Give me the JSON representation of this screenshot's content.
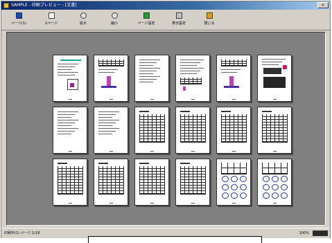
{
  "window": {
    "title": "SAMPLE - 印刷プレビュー - [文書]",
    "close_label": "×"
  },
  "toolbar": {
    "buttons": [
      {
        "label": "ページ(1)"
      },
      {
        "label": "2ページ"
      },
      {
        "label": "拡大"
      },
      {
        "label": "縮小"
      },
      {
        "label": "ページ設定"
      },
      {
        "label": "表示設定"
      },
      {
        "label": "閉じる"
      }
    ]
  },
  "status": {
    "left": "印刷中(1) ページ 1/18",
    "right": "100%"
  },
  "pages": [
    {
      "kind": "text-diagram"
    },
    {
      "kind": "table-figure"
    },
    {
      "kind": "text"
    },
    {
      "kind": "text-table"
    },
    {
      "kind": "table-figure"
    },
    {
      "kind": "photo"
    },
    {
      "kind": "text"
    },
    {
      "kind": "text"
    },
    {
      "kind": "grid"
    },
    {
      "kind": "grid"
    },
    {
      "kind": "grid"
    },
    {
      "kind": "grid"
    },
    {
      "kind": "grid"
    },
    {
      "kind": "grid"
    },
    {
      "kind": "grid"
    },
    {
      "kind": "grid"
    },
    {
      "kind": "circles"
    },
    {
      "kind": "circles"
    }
  ]
}
